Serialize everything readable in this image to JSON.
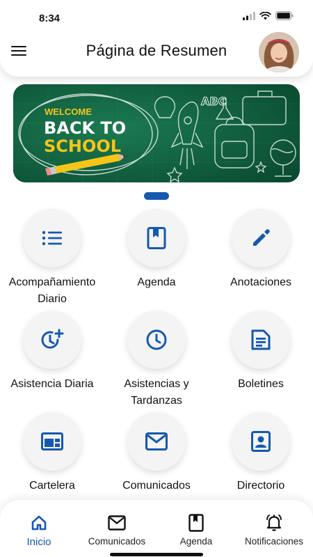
{
  "status_bar": {
    "time": "8:34"
  },
  "header": {
    "title": "Página de Resumen",
    "menu_icon": "menu-icon",
    "avatar_icon": "user-avatar"
  },
  "banner": {
    "line1": "WELCOME",
    "line2": "BACK TO",
    "line3": "SCHOOL",
    "chalk_letters": "ABC"
  },
  "carousel": {
    "active_index": 1
  },
  "colors": {
    "accent": "#1558b0",
    "banner_green": "#0e5a3c",
    "banner_yellow": "#f5c518"
  },
  "tiles": [
    {
      "label": "Acompañamiento Diario",
      "icon": "list-icon"
    },
    {
      "label": "Agenda",
      "icon": "book-icon"
    },
    {
      "label": "Anotaciones",
      "icon": "pencil-icon"
    },
    {
      "label": "Asistencia Diaria",
      "icon": "clock-plus-icon"
    },
    {
      "label": "Asistencias y Tardanzas",
      "icon": "clock-icon"
    },
    {
      "label": "Boletines",
      "icon": "document-icon"
    },
    {
      "label": "Cartelera",
      "icon": "billboard-icon"
    },
    {
      "label": "Comunicados",
      "icon": "mail-icon"
    },
    {
      "label": "Directorio",
      "icon": "contact-card-icon"
    }
  ],
  "bottom_nav": [
    {
      "label": "Inicio",
      "icon": "home-icon",
      "active": true
    },
    {
      "label": "Comunicados",
      "icon": "mail-icon",
      "active": false
    },
    {
      "label": "Agenda",
      "icon": "book-icon",
      "active": false
    },
    {
      "label": "Notificaciones",
      "icon": "bell-icon",
      "active": false
    }
  ]
}
